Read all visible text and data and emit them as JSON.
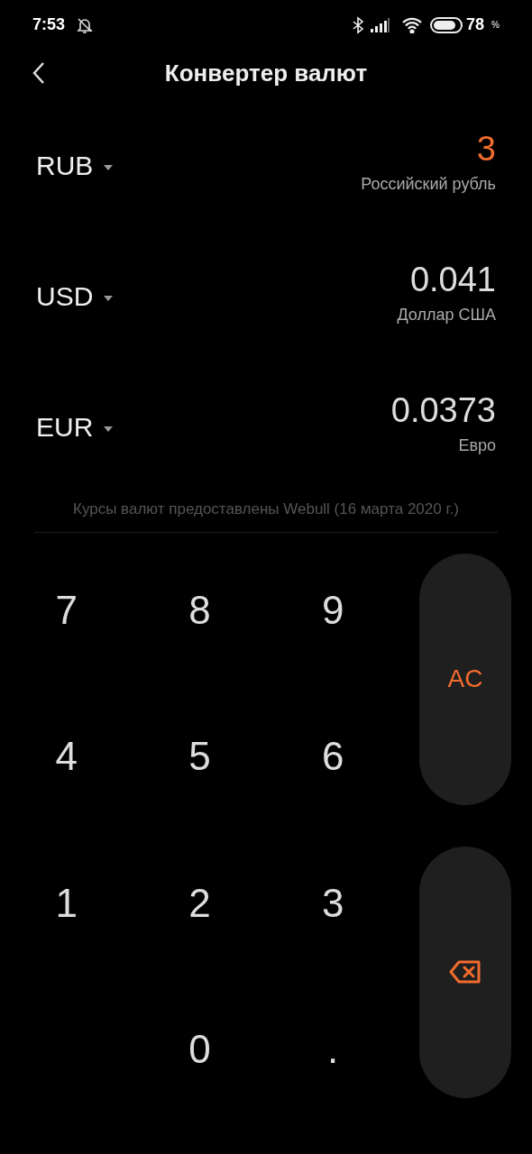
{
  "status_bar": {
    "time": "7:53",
    "battery": "78",
    "battery_unit": "%"
  },
  "header": {
    "title": "Конвертер валют"
  },
  "currencies": [
    {
      "code": "RUB",
      "value": "3",
      "name": "Российский рубль",
      "selected": true
    },
    {
      "code": "USD",
      "value": "0.041",
      "name": "Доллар США",
      "selected": false
    },
    {
      "code": "EUR",
      "value": "0.0373",
      "name": "Евро",
      "selected": false
    }
  ],
  "note": "Курсы валют предоставлены Webull (16 марта 2020 г.)",
  "keypad": {
    "rows": [
      [
        "7",
        "8",
        "9"
      ],
      [
        "4",
        "5",
        "6"
      ],
      [
        "1",
        "2",
        "3"
      ],
      [
        null,
        "0",
        "."
      ]
    ],
    "side_buttons": [
      {
        "kind": "clear",
        "label": "AC"
      },
      {
        "kind": "backspace"
      }
    ]
  }
}
